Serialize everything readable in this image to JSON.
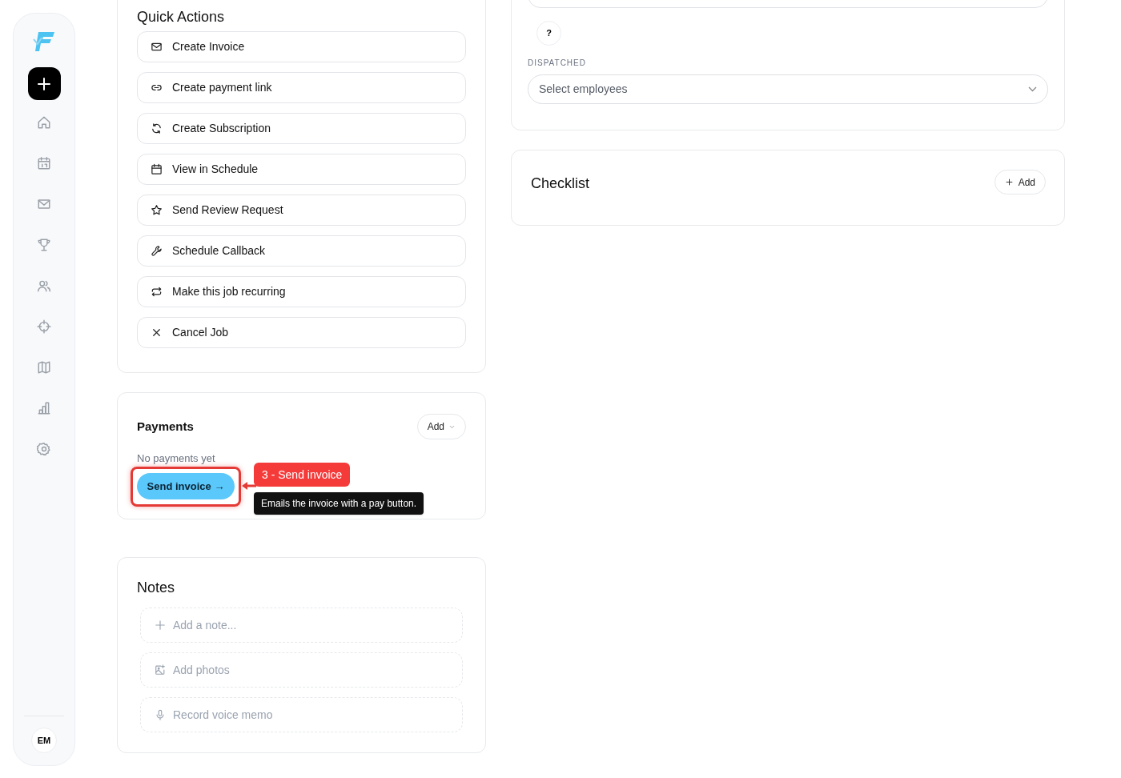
{
  "sidebar": {
    "avatar": "EM"
  },
  "quick_actions": {
    "title": "Quick Actions",
    "items": [
      "Create Invoice",
      "Create payment link",
      "Create Subscription",
      "View in Schedule",
      "Send Review Request",
      "Schedule Callback",
      "Make this job recurring",
      "Cancel Job"
    ]
  },
  "payments": {
    "title": "Payments",
    "add_button": "Add",
    "empty_text": "No payments yet",
    "send_button": "Send invoice →"
  },
  "annotation": {
    "label": "3 - Send invoice",
    "tooltip": "Emails the invoice with a pay button."
  },
  "notes": {
    "title": "Notes",
    "actions": [
      "Add a note...",
      "Add photos",
      "Record voice memo"
    ]
  },
  "dispatch": {
    "help_button": "?",
    "label": "DISPATCHED",
    "select_placeholder": "Select employees"
  },
  "checklist": {
    "title": "Checklist",
    "add_button": "Add"
  }
}
